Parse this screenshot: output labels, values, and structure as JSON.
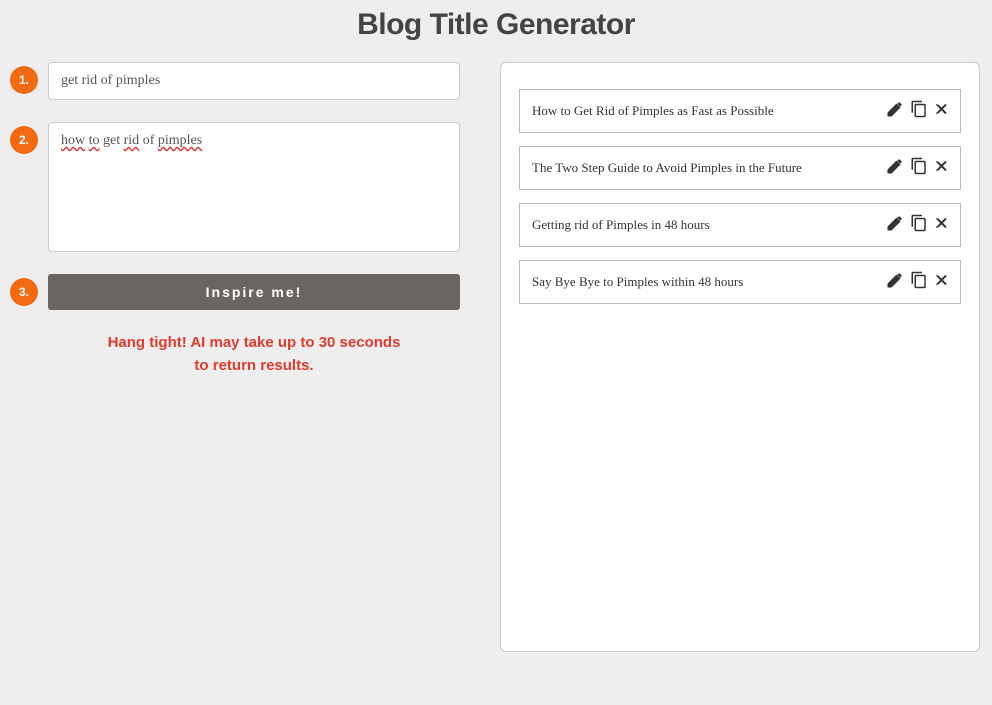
{
  "title": "Blog Title Generator",
  "steps": {
    "badge1": "1.",
    "badge2": "2.",
    "badge3": "3."
  },
  "inputs": {
    "topic_value": "get rid of pimples",
    "desc_words": [
      "how",
      "to",
      "get",
      "rid",
      "of",
      "pimples"
    ]
  },
  "button_label": "Inspire me!",
  "loading_line1": "Hang tight! AI may take up to 30 seconds",
  "loading_line2": "to return results.",
  "results": [
    {
      "title": "How to Get Rid of Pimples as Fast as Possible"
    },
    {
      "title": "The Two Step Guide to Avoid Pimples in the Future"
    },
    {
      "title": "Getting rid of Pimples in 48 hours"
    },
    {
      "title": "Say Bye Bye to Pimples within 48 hours"
    }
  ]
}
